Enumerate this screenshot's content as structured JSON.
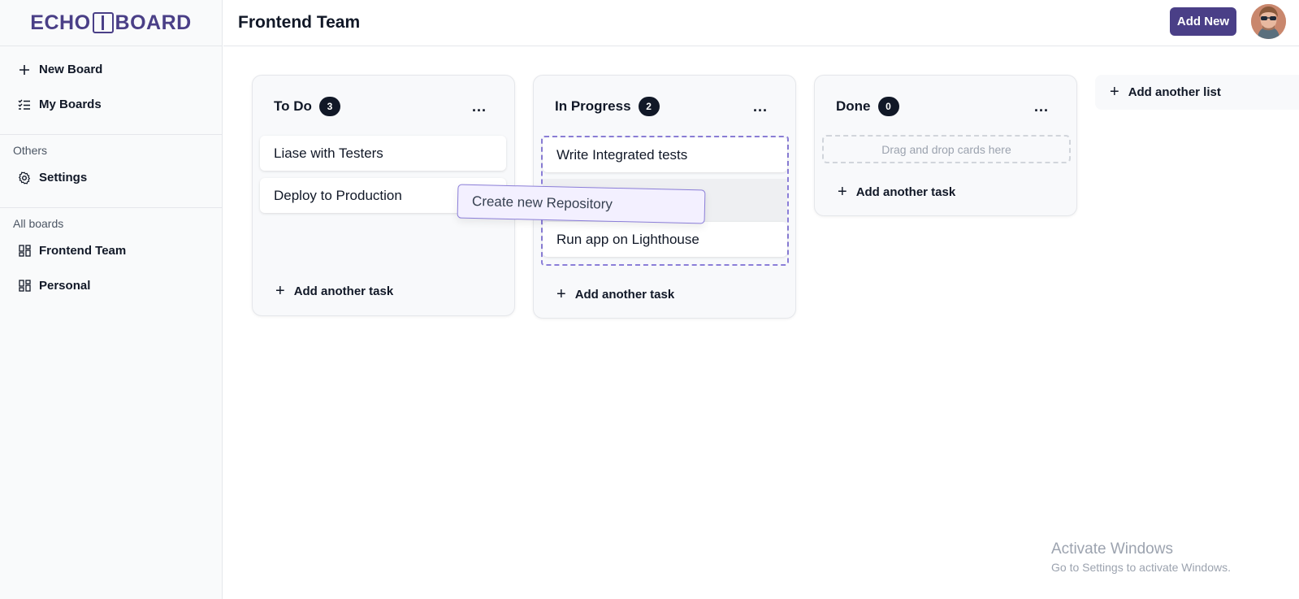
{
  "app": {
    "logo_left": "ECHO",
    "logo_right": "BOARD"
  },
  "sidebar": {
    "top_items": [
      {
        "label": "New Board",
        "icon": "plus-icon"
      },
      {
        "label": "My Boards",
        "icon": "list-check-icon"
      }
    ],
    "others_label": "Others",
    "others_items": [
      {
        "label": "Settings",
        "icon": "gear-icon"
      }
    ],
    "all_boards_label": "All boards",
    "boards": [
      {
        "label": "Frontend Team",
        "icon": "board-icon"
      },
      {
        "label": "Personal",
        "icon": "board-icon"
      }
    ]
  },
  "header": {
    "title": "Frontend Team",
    "add_new_label": "Add New"
  },
  "columns": [
    {
      "title": "To Do",
      "count": "3",
      "menu": "...",
      "cards": [
        "Liase with Testers",
        "Deploy to Production"
      ],
      "add_task": "Add another task"
    },
    {
      "title": "In Progress",
      "count": "2",
      "menu": "...",
      "cards": [
        "Write Integrated tests",
        "Run app on Lighthouse"
      ],
      "add_task": "Add another task"
    },
    {
      "title": "Done",
      "count": "0",
      "menu": "...",
      "cards": [],
      "empty_text": "Drag and drop cards here",
      "add_task": "Add another task"
    }
  ],
  "dragging_card": "Create new Repository",
  "add_list_label": "Add another list",
  "watermark": {
    "title": "Activate Windows",
    "subtitle": "Go to Settings to activate Windows."
  },
  "colors": {
    "brand": "#4a3f87",
    "badge": "#111827",
    "drop_border": "#8b7ed8"
  }
}
